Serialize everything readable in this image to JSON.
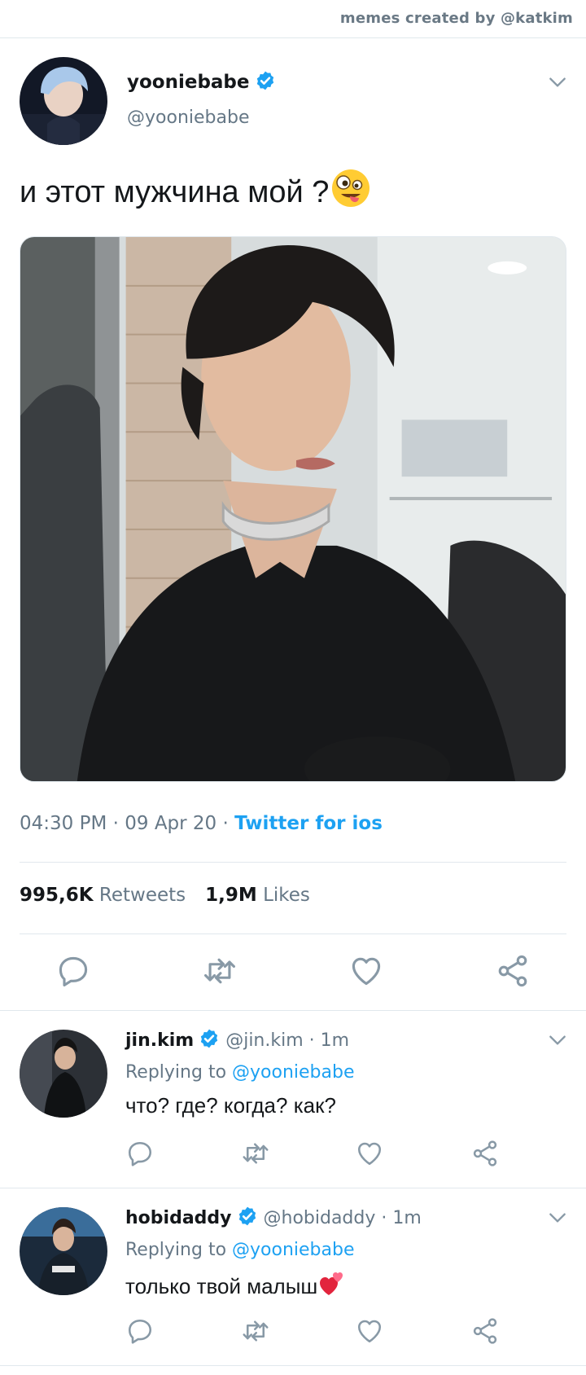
{
  "credit": "memes created by @katkim",
  "tweet": {
    "author_name": "yooniebabe",
    "author_handle": "@yooniebabe",
    "text": "и этот мужчина мой ?",
    "emoji": "zany-face",
    "time": "04:30 PM",
    "date": "09 Apr 20",
    "client": "Twitter for ios",
    "retweets_count": "995,6K",
    "retweets_label": "Retweets",
    "likes_count": "1,9M",
    "likes_label": "Likes",
    "meta_sep": " · "
  },
  "replies": [
    {
      "name": "jin.kim",
      "handle": "@jin.kim",
      "time": "1m",
      "replying_prefix": "Replying to",
      "replying_to": "@yooniebabe",
      "text": "что? где? когда? как?"
    },
    {
      "name": "hobidaddy",
      "handle": "@hobidaddy",
      "time": "1m",
      "replying_prefix": "Replying to",
      "replying_to": "@yooniebabe",
      "text": "только твой малыш",
      "emoji": "two-hearts"
    }
  ],
  "colors": {
    "accent": "#1da1f2",
    "muted": "#657786",
    "divider": "#e1e8ed",
    "icon": "#8899a6"
  },
  "icons": [
    "verified-badge-icon",
    "chevron-down-icon",
    "reply-icon",
    "retweet-icon",
    "like-icon",
    "share-icon"
  ]
}
